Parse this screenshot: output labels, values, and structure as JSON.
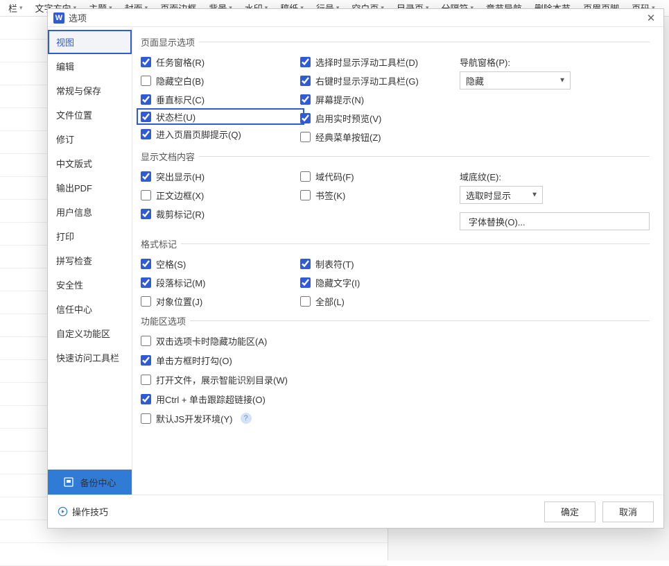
{
  "toolbar": {
    "items": [
      {
        "label": "栏",
        "caret": true
      },
      {
        "label": "文字方向",
        "caret": true
      },
      {
        "label": "主题",
        "caret": true
      },
      {
        "label": "封面",
        "caret": true
      },
      {
        "label": "页面边框",
        "caret": false
      },
      {
        "label": "背景",
        "caret": true
      },
      {
        "label": "水印",
        "caret": true
      },
      {
        "label": "稿纸",
        "caret": true
      },
      {
        "label": "行号",
        "caret": true
      },
      {
        "label": "空白页",
        "caret": true
      },
      {
        "label": "目录页",
        "caret": true
      },
      {
        "label": "分隔符",
        "caret": true
      },
      {
        "label": "章节导航",
        "caret": false
      },
      {
        "label": "删除本节",
        "caret": false,
        "disabled": true
      },
      {
        "label": "页眉页脚",
        "caret": false
      },
      {
        "label": "页码",
        "caret": true
      }
    ]
  },
  "dialog": {
    "title": "选项",
    "sidebar": [
      "视图",
      "编辑",
      "常规与保存",
      "文件位置",
      "修订",
      "中文版式",
      "输出PDF",
      "用户信息",
      "打印",
      "拼写检查",
      "安全性",
      "信任中心",
      "自定义功能区",
      "快速访问工具栏"
    ],
    "active_sidebar": 0,
    "backup_label": "备份中心",
    "tips_label": "操作技巧",
    "ok_label": "确定",
    "cancel_label": "取消",
    "groups": {
      "disp": {
        "legend": "页面显示选项",
        "col1": [
          {
            "label": "任务窗格(R)",
            "checked": true
          },
          {
            "label": "隐藏空白(B)",
            "checked": false
          },
          {
            "label": "垂直标尺(C)",
            "checked": true
          },
          {
            "label": "状态栏(U)",
            "checked": true,
            "highlight": true
          },
          {
            "label": "进入页眉页脚提示(Q)",
            "checked": true
          }
        ],
        "col2": [
          {
            "label": "选择时显示浮动工具栏(D)",
            "checked": true
          },
          {
            "label": "右键时显示浮动工具栏(G)",
            "checked": true
          },
          {
            "label": "屏幕提示(N)",
            "checked": true
          },
          {
            "label": "启用实时预览(V)",
            "checked": true
          },
          {
            "label": "经典菜单按钮(Z)",
            "checked": false
          }
        ],
        "nav_label": "导航窗格(P):",
        "nav_value": "隐藏"
      },
      "doc": {
        "legend": "显示文档内容",
        "col1": [
          {
            "label": "突出显示(H)",
            "checked": true
          },
          {
            "label": "正文边框(X)",
            "checked": false
          },
          {
            "label": "裁剪标记(R)",
            "checked": true
          }
        ],
        "col2": [
          {
            "label": "域代码(F)",
            "checked": false
          },
          {
            "label": "书签(K)",
            "checked": false
          }
        ],
        "shade_label": "域底纹(E):",
        "shade_value": "选取时显示",
        "font_sub_label": "字体替换(O)..."
      },
      "fmt": {
        "legend": "格式标记",
        "col1": [
          {
            "label": "空格(S)",
            "checked": true
          },
          {
            "label": "段落标记(M)",
            "checked": true
          },
          {
            "label": "对象位置(J)",
            "checked": false
          }
        ],
        "col2": [
          {
            "label": "制表符(T)",
            "checked": true
          },
          {
            "label": "隐藏文字(I)",
            "checked": true
          },
          {
            "label": "全部(L)",
            "checked": false
          }
        ]
      },
      "ribbon": {
        "legend": "功能区选项",
        "items": [
          {
            "label": "双击选项卡时隐藏功能区(A)",
            "checked": false
          },
          {
            "label": "单击方框时打勾(O)",
            "checked": true
          },
          {
            "label": "打开文件，展示智能识别目录(W)",
            "checked": false
          },
          {
            "label": "用Ctrl + 单击跟踪超链接(O)",
            "checked": true
          },
          {
            "label": "默认JS开发环境(Y)",
            "checked": false,
            "help": true
          }
        ]
      }
    }
  }
}
